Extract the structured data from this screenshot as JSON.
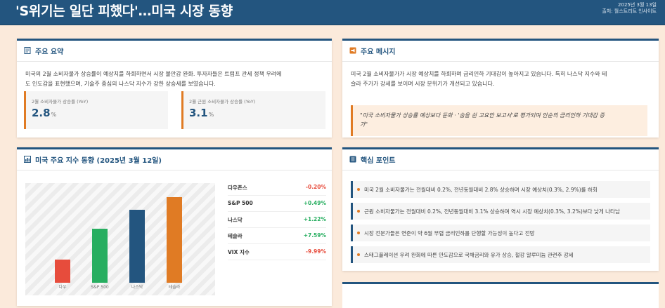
{
  "header": {
    "title": "'S위기는 일단 피했다'…미국 시장 동향",
    "date": "2025년 3월 13일",
    "source": "출처: 월스트리트 인사이트"
  },
  "summary": {
    "title": "주요 요약",
    "body_lines": [
      "미국의 2월 소비자물가 상승률이 예상치를 하회하면서 시장 불안감 완화. 투자자들은 트럼프 관세 정책 우려에",
      "도 인도감을 표현했으며, 기술주 중심의 나스닥 지수가 강한 상승세를 보였습니다."
    ],
    "stats": [
      {
        "label": "2월 소비자물가 상승률 (YoY)",
        "value": "2.8",
        "unit": "%"
      },
      {
        "label": "2월 근원 소비자물가 상승률 (YoY)",
        "value": "3.1",
        "unit": "%"
      }
    ]
  },
  "message": {
    "title": "주요 메시지",
    "body_lines": [
      "미국 2월 소비자물가가 시장 예상치를 하회하며 금리인하 기대감이 높아지고 있습니다. 특히 나스닥 지수와 테",
      "슬라 주가가 강세를 보이며 시장 분위기가 개선되고 있습니다."
    ],
    "quote_lines": [
      "\"미국 소비자물가 상승률 예상보다 둔화 · '숨을 쉰 고요안 보고서'로 평가되며 안순의 금리인하 기대감 증",
      "가\""
    ]
  },
  "indices": {
    "title": "미국 주요 지수 동향 (2025년 3월 12일)",
    "rows": [
      {
        "name": "다우존스",
        "change": "-0.20%",
        "dir": "down"
      },
      {
        "name": "S&P 500",
        "change": "+0.49%",
        "dir": "up"
      },
      {
        "name": "나스닥",
        "change": "+1.22%",
        "dir": "up"
      },
      {
        "name": "테슬라",
        "change": "+7.59%",
        "dir": "up"
      },
      {
        "name": "VIX 지수",
        "change": "-9.99%",
        "dir": "down"
      }
    ]
  },
  "chart_data": {
    "type": "bar",
    "categories": [
      "다우",
      "S&P 500",
      "나스닥",
      "테슬라"
    ],
    "values": [
      0.8,
      1.9,
      2.55,
      3.0
    ],
    "colors": [
      "#e74c3c",
      "#27ae60",
      "#23557f",
      "#e07b24"
    ],
    "ylim": [
      0,
      3.2
    ],
    "grid": false,
    "title": "",
    "xlabel": "",
    "ylabel": ""
  },
  "points": {
    "title": "핵심 포인트",
    "items": [
      "미국 2월 소비자물가는 전월대비 0.2%, 전년동월대비 2.8% 상승하며 시장 예상치(0.3%, 2.9%)를 하회",
      "근원 소비자물가는 전월대비 0.2%, 전년동월대비 3.1% 상승하며 역시 시장 예상치(0.3%, 3.2%)보다 낮게 나타남",
      "시장 전문가들은 연준이 약 6월 무렵 금리인하를 단행할 가능성이 높다고 전망",
      "스태그플레이션 우려 완화에 따른 안도감으로 국채금리와 유가 상승, 철강 알루미늄 관련주 강세"
    ]
  },
  "colors": {
    "header": "#23557f",
    "accent": "#e07b24",
    "up": "#27ae60",
    "down": "#e74c3c"
  }
}
